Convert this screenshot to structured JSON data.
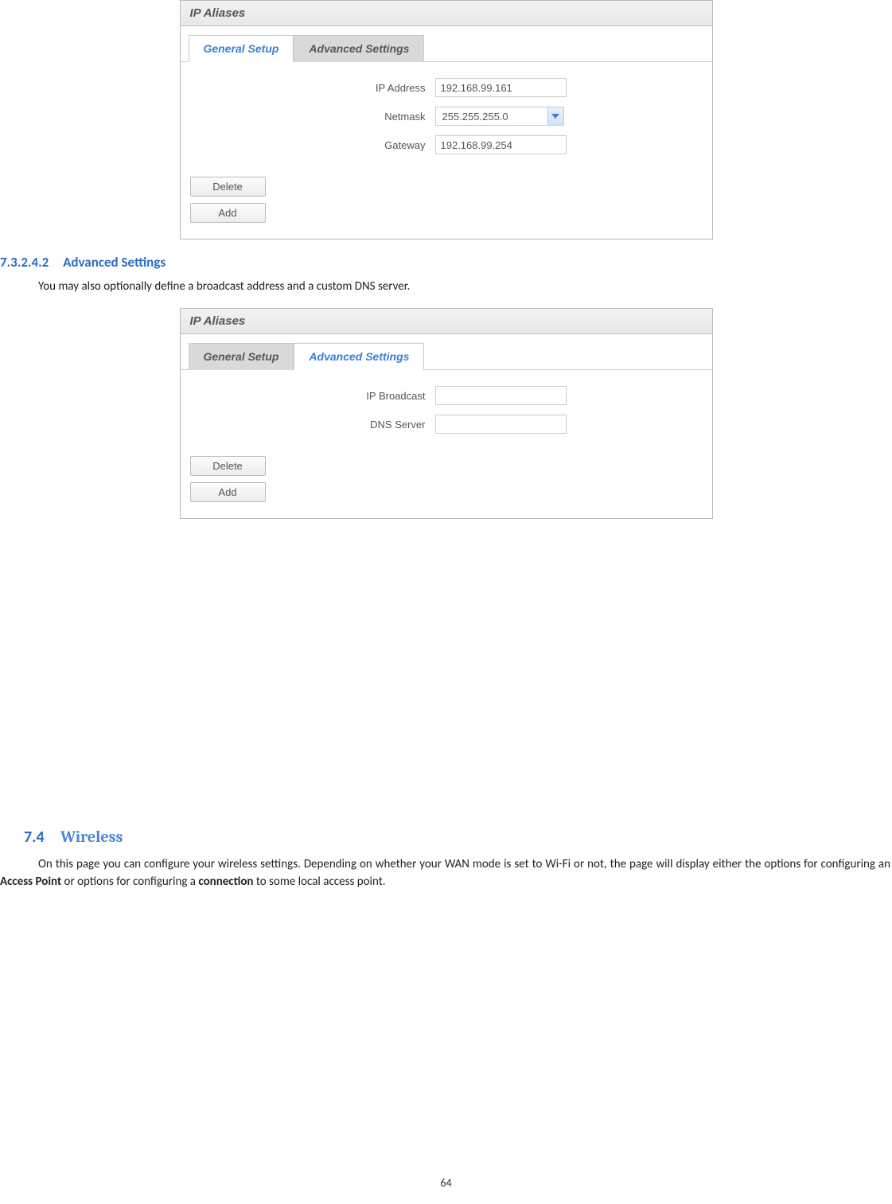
{
  "panel1": {
    "title": "IP Aliases",
    "tabs": {
      "general": "General Setup",
      "advanced": "Advanced Settings"
    },
    "fields": {
      "ip_address_label": "IP Address",
      "ip_address_value": "192.168.99.161",
      "netmask_label": "Netmask",
      "netmask_value": "255.255.255.0",
      "gateway_label": "Gateway",
      "gateway_value": "192.168.99.254"
    },
    "buttons": {
      "delete": "Delete",
      "add": "Add"
    }
  },
  "section_7_3_2_4_2": {
    "number": "7.3.2.4.2",
    "title": "Advanced Settings",
    "body": "You may also optionally define a broadcast address and a custom DNS server."
  },
  "panel2": {
    "title": "IP Aliases",
    "tabs": {
      "general": "General Setup",
      "advanced": "Advanced Settings"
    },
    "fields": {
      "ip_broadcast_label": "IP Broadcast",
      "ip_broadcast_value": "",
      "dns_server_label": "DNS Server",
      "dns_server_value": ""
    },
    "buttons": {
      "delete": "Delete",
      "add": "Add"
    }
  },
  "section_7_4": {
    "number": "7.4",
    "title": "Wireless",
    "body_prefix": "On this page you can configure your wireless settings. Depending on whether your WAN mode is set to Wi-Fi or not, the page will display either the options for configuring an ",
    "bold1": "Access Point",
    "body_mid": " or options for configuring a ",
    "bold2": "connection",
    "body_suffix": " to some local access point."
  },
  "page_number": "64"
}
